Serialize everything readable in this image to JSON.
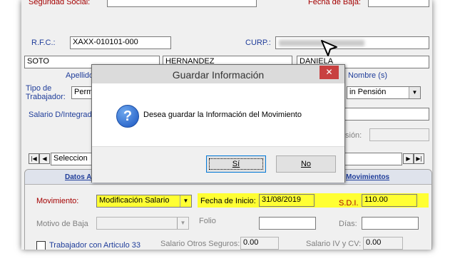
{
  "background_form": {
    "seguridad_social_label": "Seguridad Social:",
    "fecha_baja_label": "Fecha de Baja:",
    "rfc_label": "R.F.C.:",
    "rfc_value": "XAXX-010101-000",
    "curp_label": "CURP.:",
    "apellido_paterno_value": "SOTO",
    "apellido_materno_value": "HERNANDEZ",
    "nombre_value": "DANIELA",
    "apellido_label": "Apellido",
    "nombres_label": "Nombre (s)",
    "tipo_trabajador_label_1": "Tipo de",
    "tipo_trabajador_label_2": "Trabajador:",
    "tipo_trabajador_value": "Perm",
    "pension_value": "in Pensión",
    "salario_label": "Salario D/Integrad",
    "pension_label": "sión:",
    "selection_text": "Seleccion"
  },
  "tabs": {
    "datos_tab": "Datos A",
    "movimientos_tab": "Movimientos"
  },
  "movement": {
    "movimiento_label": "Movimiento:",
    "movimiento_value": "Modificación Salario",
    "fecha_inicio_label": "Fecha de Inicio:",
    "fecha_inicio_value": "31/08/2019",
    "sdi_label": "S.D.I.",
    "sdi_value": "110.00",
    "motivo_baja_label": "Motivo de Baja",
    "folio_label": "Folio",
    "dias_label": "Días:",
    "articulo_label": "Trabajador con Articulo 33",
    "salario_otros_label": "Salario Otros Seguros:",
    "salario_otros_value": "0.00",
    "salario_iv_label": "Salario IV y CV:",
    "salario_iv_value": "0.00"
  },
  "dialog": {
    "title": "Guardar Información",
    "close_glyph": "✕",
    "icon_glyph": "?",
    "message": "Desea guardar la Información del Movimiento",
    "yes_label": "Sí",
    "no_label": "No"
  },
  "icons": {
    "question": "question-icon",
    "close": "close-icon",
    "dropdown": "chevron-down-icon",
    "cursor": "mouse-cursor-icon"
  },
  "colors": {
    "label_red": "#a40000",
    "label_blue": "#1f3d9a",
    "highlight": "#ffff33",
    "close_red": "#c84040"
  }
}
